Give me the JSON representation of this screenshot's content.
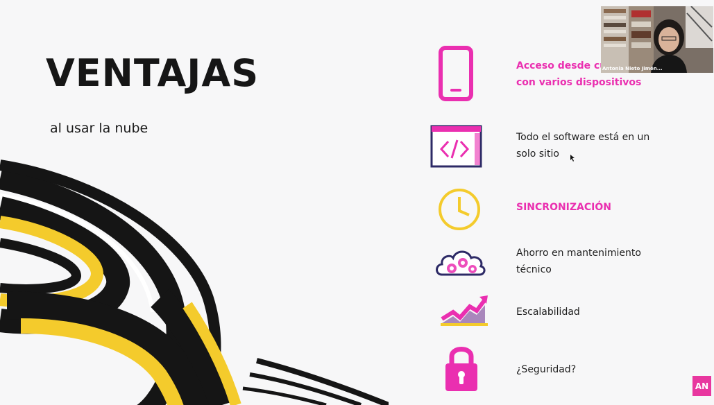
{
  "slide": {
    "title": "VENTAJAS",
    "subtitle": "al usar la nube",
    "benefits": [
      {
        "icon": "smartphone-icon",
        "text_line1": "Acceso desde cualquier lugar",
        "text_line2": "con varios dispositivos",
        "highlight": true
      },
      {
        "icon": "code-window-icon",
        "text_line1": "Todo el software está en un",
        "text_line2": "solo sitio",
        "highlight": false
      },
      {
        "icon": "clock-icon",
        "text_line1": "SINCRONIZACIÓN",
        "text_line2": "",
        "highlight": true
      },
      {
        "icon": "cloud-gears-icon",
        "text_line1": "Ahorro en mantenimiento",
        "text_line2": "técnico",
        "highlight": false
      },
      {
        "icon": "growth-chart-icon",
        "text_line1": "Escalabilidad",
        "text_line2": "",
        "highlight": false
      },
      {
        "icon": "padlock-icon",
        "text_line1": "¿Seguridad?",
        "text_line2": "",
        "highlight": false
      }
    ]
  },
  "webcam": {
    "participant_name": "Antonia Nieto Jimén..."
  },
  "presenter_badge": {
    "initials": "AN"
  },
  "colors": {
    "accent": "#ea2fb0",
    "yellow": "#f4cb2c",
    "dark": "#161616",
    "background": "#f7f7f8"
  }
}
